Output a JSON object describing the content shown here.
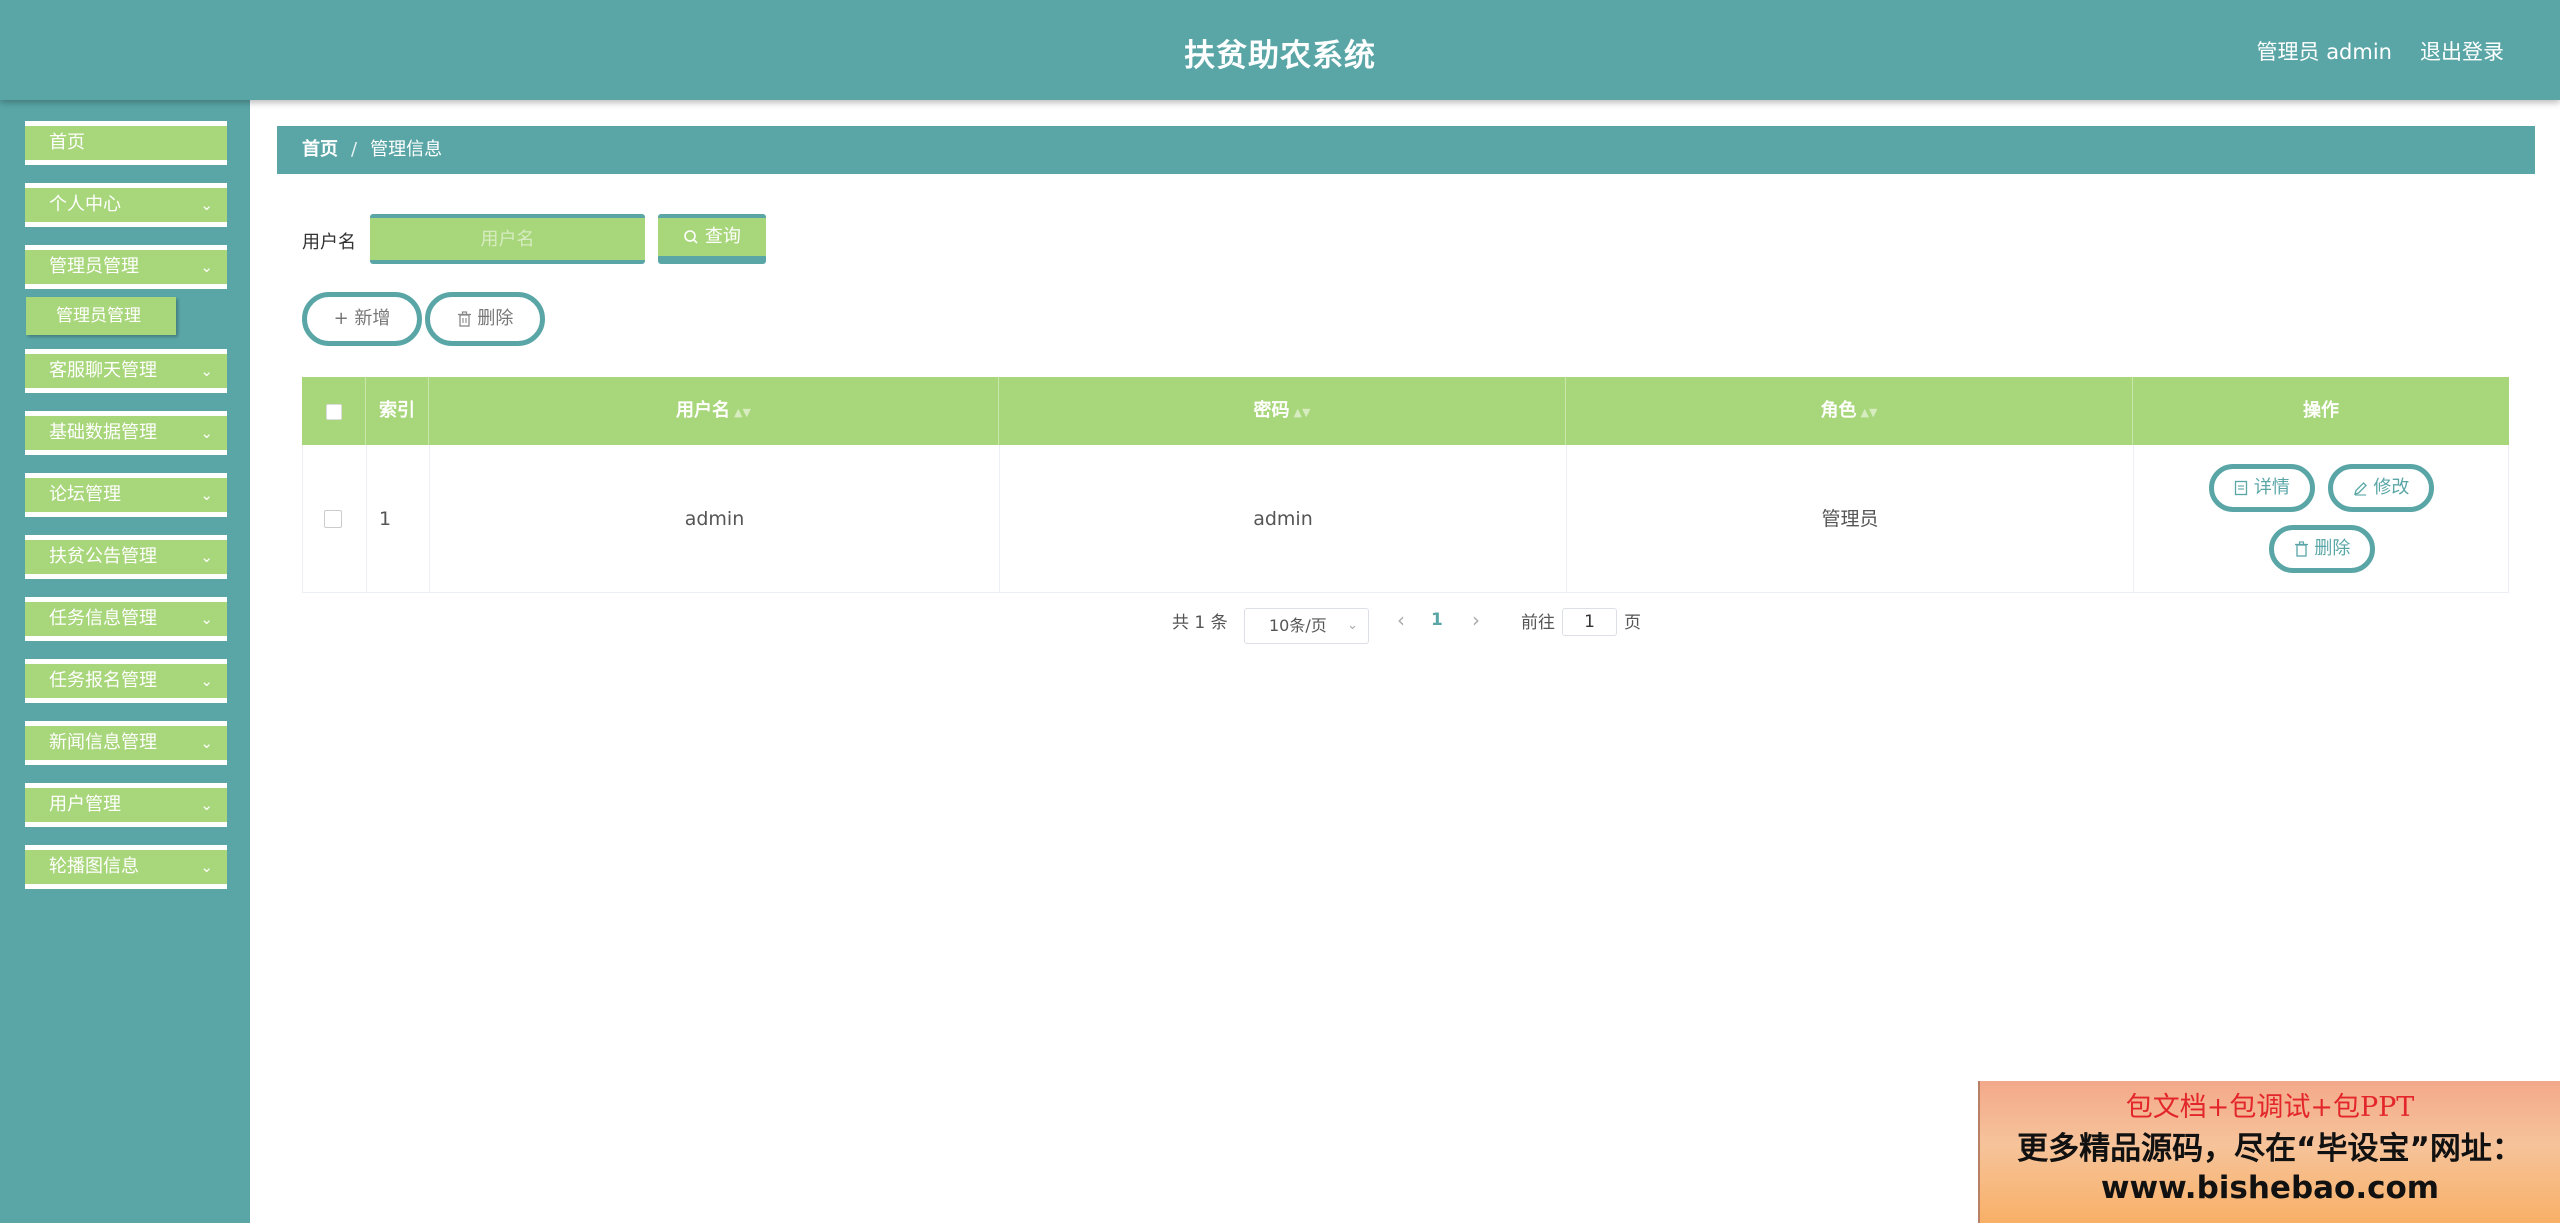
{
  "header": {
    "title": "扶贫助农系统",
    "user": "管理员 admin",
    "logout": "退出登录"
  },
  "sidebar": {
    "items": [
      {
        "label": "首页"
      },
      {
        "label": "个人中心"
      },
      {
        "label": "管理员管理"
      },
      {
        "label": "客服聊天管理"
      },
      {
        "label": "基础数据管理"
      },
      {
        "label": "论坛管理"
      },
      {
        "label": "扶贫公告管理"
      },
      {
        "label": "任务信息管理"
      },
      {
        "label": "任务报名管理"
      },
      {
        "label": "新闻信息管理"
      },
      {
        "label": "用户管理"
      },
      {
        "label": "轮播图信息"
      }
    ],
    "sub_item": "管理员管理"
  },
  "breadcrumb": {
    "home": "首页",
    "separator": "/",
    "current": "管理信息"
  },
  "search": {
    "label": "用户名",
    "placeholder": "用户名",
    "button": "查询"
  },
  "actions": {
    "add": "新增",
    "delete": "删除"
  },
  "table": {
    "columns": [
      "索引",
      "用户名",
      "密码",
      "角色",
      "操作"
    ],
    "rows": [
      {
        "index": "1",
        "username": "admin",
        "password": "admin",
        "role": "管理员"
      }
    ],
    "row_actions": {
      "detail": "详情",
      "edit": "修改",
      "delete": "删除"
    }
  },
  "pagination": {
    "total": "共 1 条",
    "page_size": "10条/页",
    "current_page": "1",
    "goto_prefix": "前往",
    "goto_value": "1",
    "goto_suffix": "页"
  },
  "banner": {
    "line1": "包文档+包调试+包PPT",
    "line2": "更多精品源码，尽在“毕设宝”网址：",
    "line3": "www.bishebao.com"
  },
  "colors": {
    "primary": "#5aa6a7",
    "accent": "#a8d67a"
  }
}
